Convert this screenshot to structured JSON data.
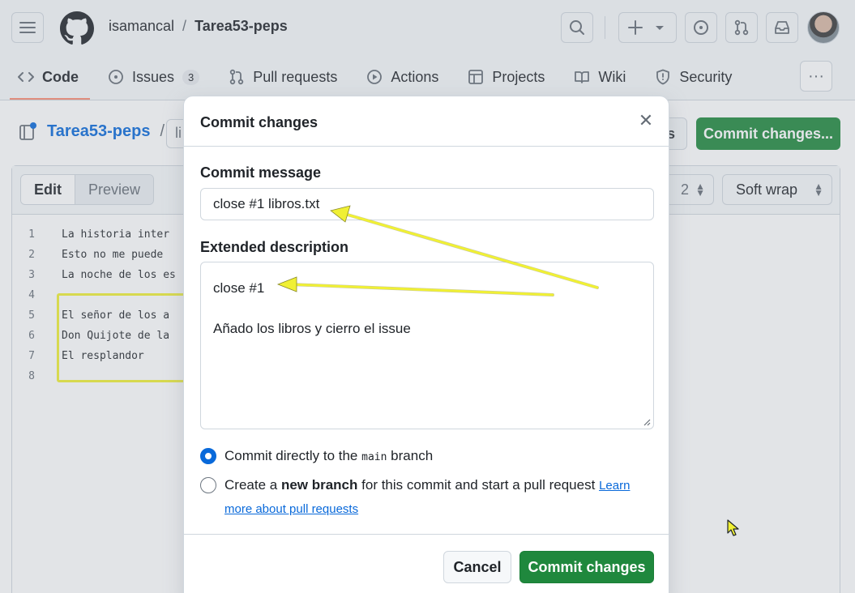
{
  "header": {
    "owner": "isamancal",
    "separator": "/",
    "repo": "Tarea53-peps",
    "icons": [
      "menu-icon",
      "github-logo",
      "search-icon",
      "plus-icon",
      "issue-icon",
      "pull-request-icon",
      "inbox-icon",
      "avatar"
    ]
  },
  "nav": {
    "tabs": [
      {
        "label": "Code",
        "icon": "code-icon",
        "selected": true
      },
      {
        "label": "Issues",
        "icon": "issue-icon",
        "count": "3"
      },
      {
        "label": "Pull requests",
        "icon": "pull-request-icon"
      },
      {
        "label": "Actions",
        "icon": "play-icon"
      },
      {
        "label": "Projects",
        "icon": "table-icon"
      },
      {
        "label": "Wiki",
        "icon": "book-icon"
      },
      {
        "label": "Security",
        "icon": "shield-icon"
      }
    ],
    "more": "···"
  },
  "page": {
    "repo_link": "Tarea53-peps",
    "slash": "/",
    "file_prefix": "li",
    "cancel_partial": "s",
    "commit_button": "Commit changes..."
  },
  "editor": {
    "mode_edit": "Edit",
    "mode_preview": "Preview",
    "indent_partial": "2",
    "wrap": "Soft wrap",
    "lines": [
      {
        "n": "1",
        "text": "La historia inter"
      },
      {
        "n": "2",
        "text": "Esto no me puede "
      },
      {
        "n": "3",
        "text": "La noche de los es"
      },
      {
        "n": "4",
        "text": ""
      },
      {
        "n": "5",
        "text": "El señor de los a"
      },
      {
        "n": "6",
        "text": "Don Quijote de la"
      },
      {
        "n": "7",
        "text": "El resplandor"
      },
      {
        "n": "8",
        "text": ""
      }
    ]
  },
  "modal": {
    "title": "Commit changes",
    "close": "✕",
    "commit_message_label": "Commit message",
    "commit_message_value": "close #1 libros.txt",
    "extended_label": "Extended description",
    "extended_lines": [
      "close #1",
      "",
      "Añado los libros y cierro el issue"
    ],
    "option_direct_pre": "Commit directly to the",
    "option_direct_branch": "main",
    "option_direct_post": "branch",
    "option_new_pre": "Create a",
    "option_new_bold": "new branch",
    "option_new_post": "for this commit and start a pull request",
    "learn_more_1": "Learn",
    "learn_more_2": "more about pull requests",
    "cancel": "Cancel",
    "commit": "Commit changes"
  },
  "colors": {
    "accent_blue": "#0969da",
    "primary_green": "#1f883d",
    "annotation_yellow": "#f0f034",
    "tab_underline": "#fd8c73"
  }
}
